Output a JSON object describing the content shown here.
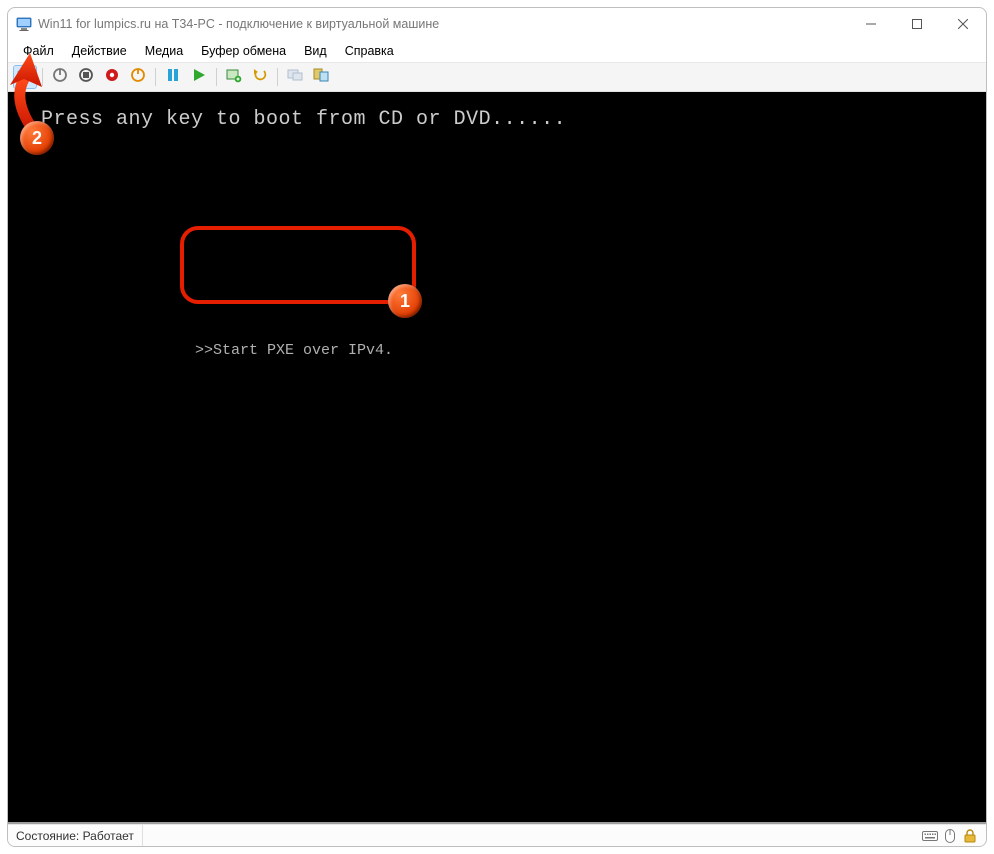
{
  "window": {
    "title": "Win11 for lumpics.ru на T34-PC - подключение к виртуальной машине"
  },
  "menu": {
    "items": [
      "Файл",
      "Действие",
      "Медиа",
      "Буфер обмена",
      "Вид",
      "Справка"
    ]
  },
  "toolbar": {
    "icons": [
      "ctrl-alt-del-icon",
      "power-off-icon",
      "shutdown-icon",
      "force-off-icon",
      "reset-icon",
      "pause-icon",
      "start-icon",
      "snapshot-icon",
      "revert-icon",
      "share-icon",
      "enhanced-session-icon"
    ]
  },
  "console": {
    "boot_prompt": "Press any key to boot from CD or DVD......",
    "pxe_line": ">>Start PXE over IPv4."
  },
  "statusbar": {
    "state_label": "Состояние:",
    "state_value": "Работает"
  },
  "annotations": {
    "marker1": "1",
    "marker2": "2"
  }
}
